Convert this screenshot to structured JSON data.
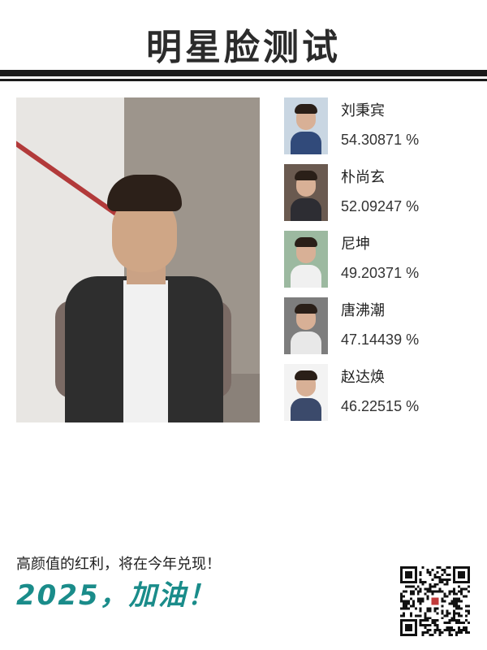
{
  "header": {
    "title": "明星脸测试"
  },
  "photo": {
    "subject": "user-portrait"
  },
  "matches": [
    {
      "name": "刘秉宾",
      "score": "54.30871 %",
      "bg": "#c9d6e2",
      "shirt": "#314a7a"
    },
    {
      "name": "朴尚玄",
      "score": "52.09247 %",
      "bg": "#6a5a50",
      "shirt": "#2d2d33"
    },
    {
      "name": "尼坤",
      "score": "49.20371 %",
      "bg": "#9cb9a0",
      "shirt": "#f0f0f0"
    },
    {
      "name": "唐沸潮",
      "score": "47.14439 %",
      "bg": "#7d7d7d",
      "shirt": "#e8e8e8"
    },
    {
      "name": "赵达焕",
      "score": "46.22515 %",
      "bg": "#f3f3f3",
      "shirt": "#3b4a6b"
    }
  ],
  "footer": {
    "slogan": "高颜值的红利，将在今年兑现！",
    "cheer": "2025，加油！"
  },
  "colors": {
    "accent": "#1a8c8a",
    "rule": "#1a1a1a"
  },
  "icons": {
    "qr": "qr-code-icon"
  }
}
